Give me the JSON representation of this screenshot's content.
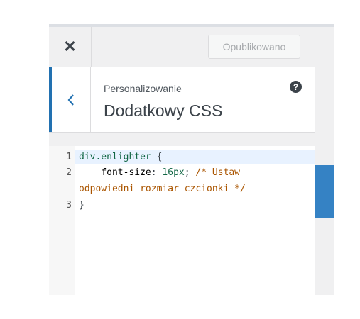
{
  "header": {
    "close_icon": "close-icon",
    "publish_label": "Opublikowano"
  },
  "section": {
    "back_icon": "chevron-left-icon",
    "breadcrumb": "Personalizowanie",
    "title": "Dodatkowy CSS",
    "help_icon": "question-icon"
  },
  "editor": {
    "line_numbers": [
      "1",
      "2",
      "3"
    ],
    "line1": {
      "selector": "div.enlighter",
      "brace": " {"
    },
    "line2": {
      "indent": "    ",
      "property": "font-size",
      "colon": ": ",
      "value": "16px",
      "semi": "; ",
      "comment_start": "/* Ustaw"
    },
    "line2_wrap": {
      "comment_end": "odpowiedni rozmiar czcionki */"
    },
    "line3": {
      "brace": "}"
    }
  },
  "colors": {
    "accent": "#2271b1",
    "preview_blue": "#3582c4"
  }
}
